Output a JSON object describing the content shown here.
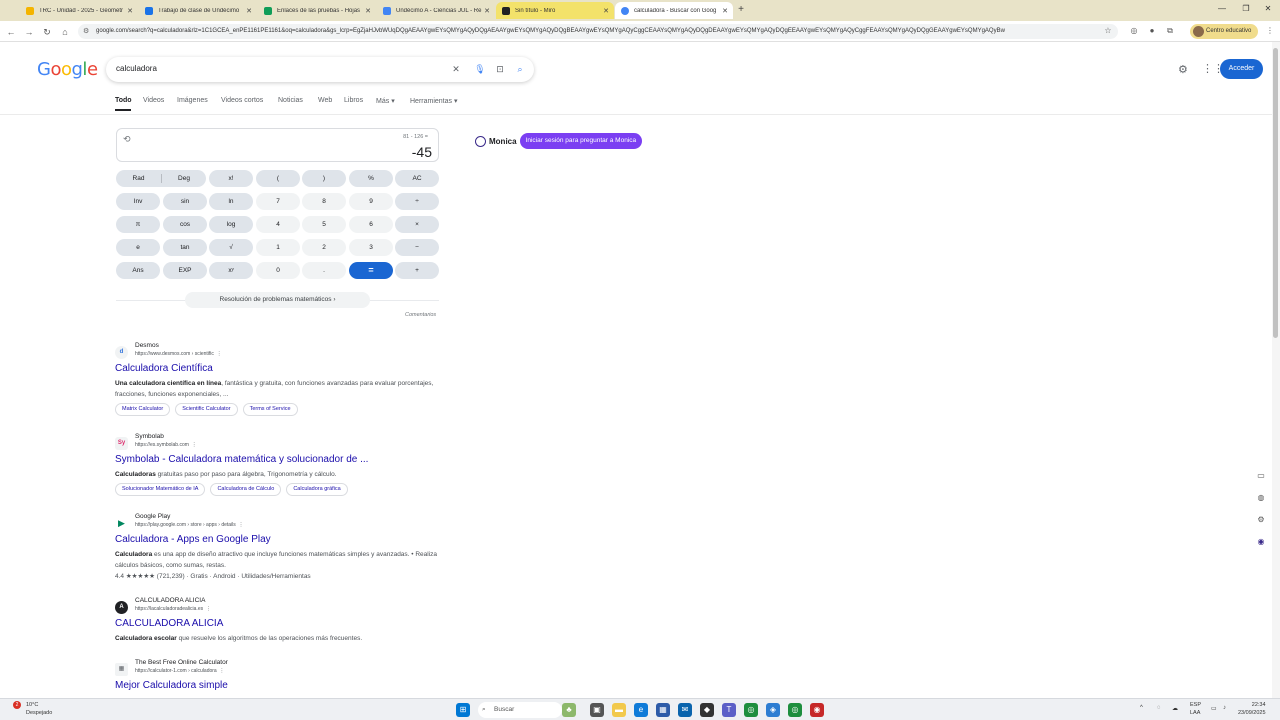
{
  "browser": {
    "tabs": [
      {
        "title": "TRC - Unidad - 2025 - Geometr",
        "color": "#f4b400"
      },
      {
        "title": "Trabajo de clase de Undécimo",
        "color": "#1a73e8"
      },
      {
        "title": "Enlaces de las pruebas - Hojas",
        "color": "#0f9d58"
      },
      {
        "title": "Undécimo A - Ciencias JUL - Re",
        "color": "#4285f4"
      },
      {
        "title": "Sin título - Miro",
        "color": "#ffd02f"
      },
      {
        "title": "calculadora - Buscar con Goog",
        "color": "#4285f4"
      }
    ],
    "url": "google.com/search?q=calculadora&rlz=1C1GCEA_enPE1161PE1161&oq=calculadora&gs_lcrp=EgZjaHJvbWUqDQgAEAAYgwEYsQMYgAQyDQgAEAAYgwEYsQMYgAQyDQgBEAAYgwEYsQMYgAQyCggCEAAYsQMYgAQyDQgDEAAYgwEYsQMYgAQyDQgEEAAYgwEYsQMYgAQyCggFEAAYsQMYgAQyDQgGEAAYgwEYsQMYgAQyBw",
    "profile_label": "Centro educativo"
  },
  "google": {
    "query": "calculadora",
    "signin_label": "Acceder",
    "filters": [
      "Todo",
      "Videos",
      "Imágenes",
      "Videos cortos",
      "Noticias",
      "Web",
      "Libros",
      "Más",
      "Herramientas"
    ]
  },
  "calculator": {
    "expression": "81 - 126 =",
    "result": "-45",
    "keys": [
      [
        "Rad | Deg",
        "x!",
        "(",
        ")",
        "%",
        "AC"
      ],
      [
        "Inv",
        "sin",
        "ln",
        "7",
        "8",
        "9",
        "÷"
      ],
      [
        "π",
        "cos",
        "log",
        "4",
        "5",
        "6",
        "×"
      ],
      [
        "e",
        "tan",
        "√",
        "1",
        "2",
        "3",
        "−"
      ],
      [
        "Ans",
        "EXP",
        "xʸ",
        "0",
        ".",
        "=",
        "+"
      ]
    ],
    "rad_label": "Rad",
    "deg_label": "Deg",
    "solver_label": "Resolución de problemas matemáticos",
    "feedback_label": "Comentarios"
  },
  "monica": {
    "name": "Monica",
    "button": "Iniciar sesión para preguntar a Monica"
  },
  "results": [
    {
      "site": "Desmos",
      "url": "https://www.desmos.com › scientific",
      "title": "Calculadora Científica",
      "snippet_bold": "Una calculadora científica en línea",
      "snippet": ", fantástica y gratuita, con funciones avanzadas para evaluar porcentajes, fracciones, funciones exponenciales, ...",
      "chips": [
        "Matrix Calculator",
        "Scientific Calculator",
        "Terms of Service"
      ],
      "favicon": "d",
      "favicon_color": "#2f72dc"
    },
    {
      "site": "Symbolab",
      "url": "https://es.symbolab.com",
      "title": "Symbolab - Calculadora matemática y solucionador de ...",
      "snippet_bold": "Calculadoras",
      "snippet": " gratuitas paso por paso para álgebra, Trigonometría y cálculo.",
      "chips": [
        "Solucionador Matemático de IA",
        "Calculadora de Cálculo",
        "Calculadora gráfica"
      ],
      "favicon": "Sy",
      "favicon_color": "#dd2a6b"
    },
    {
      "site": "Google Play",
      "url": "https://play.google.com › store › apps › details",
      "title": "Calculadora - Apps en Google Play",
      "snippet_bold": "Calculadora",
      "snippet": " es una app de diseño atractivo que incluye funciones matemáticas simples y avanzadas. • Realiza cálculos básicos, como sumas, restas.",
      "rating_line": "4.4 ★★★★★ (721,239) · Gratis · Android · Utilidades/Herramientas",
      "favicon": "▶",
      "favicon_color": "#01875f"
    },
    {
      "site": "CALCULADORA ALICIA",
      "url": "https://lacalculadoradealicia.es",
      "title": "CALCULADORA ALICIA",
      "snippet_bold": "Calculadora escolar",
      "snippet": " que resuelve los algoritmos de las operaciones más frecuentes.",
      "favicon": "A",
      "favicon_color": "#202124"
    },
    {
      "site": "The Best Free Online Calculator",
      "url": "https://calculator-1.com › calculadora",
      "title": "Mejor Calculadora simple",
      "favicon": "▦",
      "favicon_color": "#5f6368"
    }
  ],
  "taskbar": {
    "temperature": "10°C",
    "weather": "Despejado",
    "notification_count": "2",
    "search_placeholder": "Buscar",
    "lang1": "ESP",
    "lang2": "LAA",
    "time": "22:34",
    "date": "23/09/2025"
  },
  "colors": {
    "google_blue": "#1a66d2",
    "link": "#1a0dab",
    "monica_purple": "#7b3ff2",
    "tab_strip": "#e8e3c8"
  }
}
